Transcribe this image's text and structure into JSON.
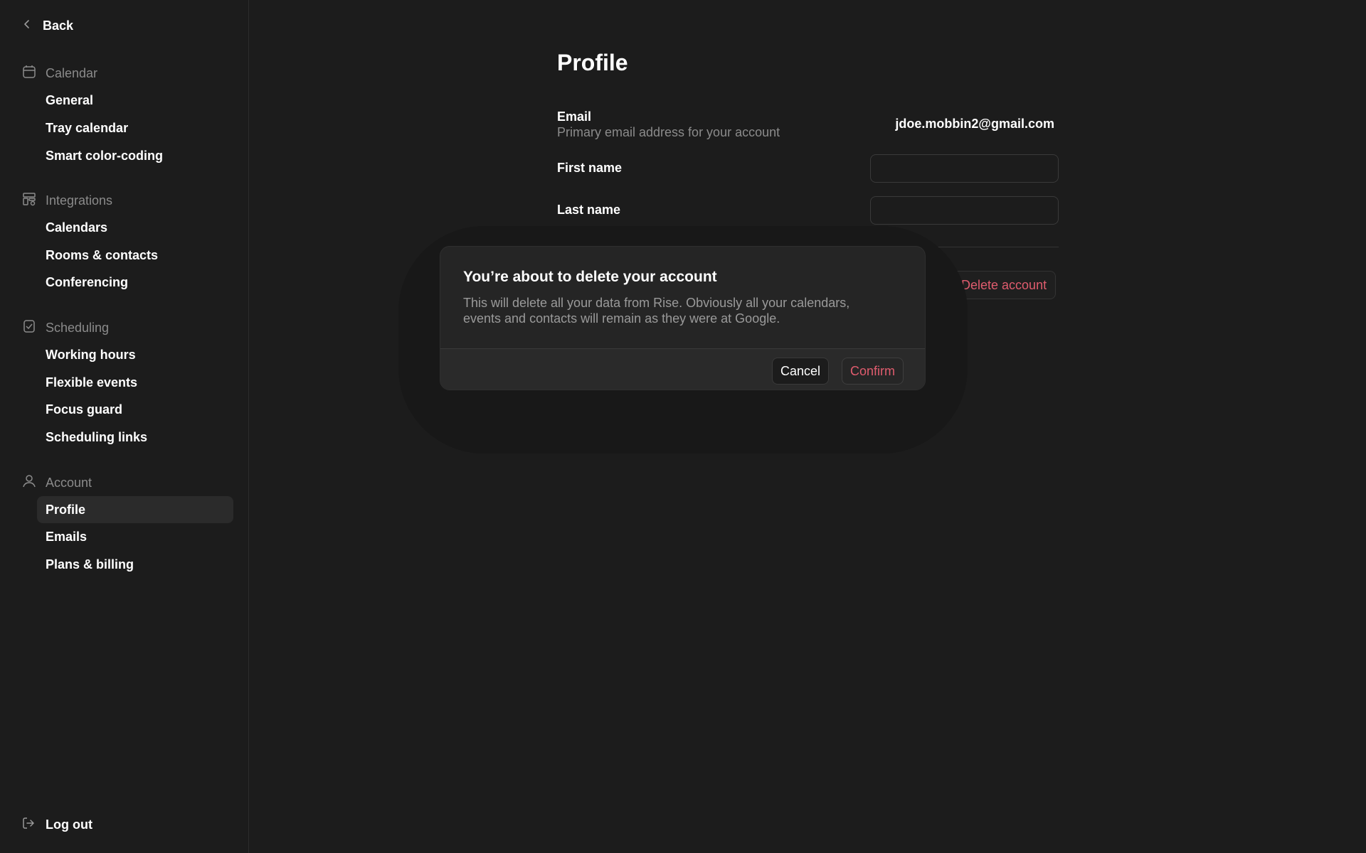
{
  "sidebar": {
    "back_label": "Back",
    "sections": [
      {
        "title": "Calendar",
        "icon": "calendar-icon",
        "items": [
          "General",
          "Tray calendar",
          "Smart color-coding"
        ]
      },
      {
        "title": "Integrations",
        "icon": "integrations-icon",
        "items": [
          "Calendars",
          "Rooms & contacts",
          "Conferencing"
        ]
      },
      {
        "title": "Scheduling",
        "icon": "scheduling-icon",
        "items": [
          "Working hours",
          "Flexible events",
          "Focus guard",
          "Scheduling links"
        ]
      },
      {
        "title": "Account",
        "icon": "user-icon",
        "items": [
          "Profile",
          "Emails",
          "Plans & billing"
        ]
      }
    ],
    "active_item": "Profile",
    "logout_label": "Log out"
  },
  "main": {
    "title": "Profile",
    "email_label": "Email",
    "email_sub": "Primary email address for your account",
    "email_value": "jdoe.mobbin2@gmail.com",
    "first_name_label": "First name",
    "first_name_value": "",
    "last_name_label": "Last name",
    "last_name_value": "",
    "delete_account_label": "Delete account"
  },
  "modal": {
    "title": "You’re about to delete your account",
    "body": "This will delete all your data from Rise. Obviously all your calendars, events and contacts will remain as they were at Google.",
    "cancel_label": "Cancel",
    "confirm_label": "Confirm"
  },
  "colors": {
    "background": "#1c1c1c",
    "danger": "#e05c6e",
    "muted": "#8b8b8b"
  }
}
